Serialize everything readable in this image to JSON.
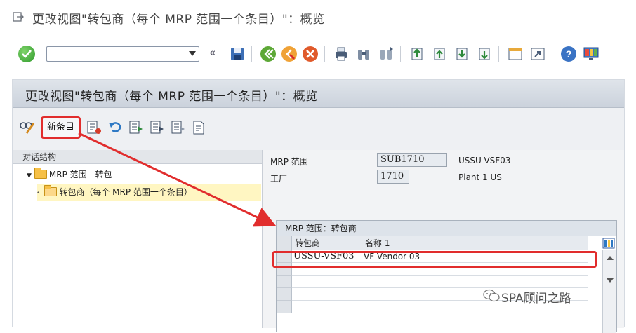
{
  "window": {
    "title": "更改视图\"转包商（每个 MRP 范围一个条目）\"：概览"
  },
  "toolbar": {
    "command_value": "",
    "collapse_symbol": "«"
  },
  "panel": {
    "title": "更改视图\"转包商（每个 MRP 范围一个条目）\"：概览"
  },
  "app_toolbar": {
    "new_entries_label": "新条目"
  },
  "dialog_structure": {
    "header": "对话结构",
    "nodes": [
      {
        "label": "MRP 范围 - 转包"
      },
      {
        "label": "转包商（每个 MRP 范围一个条目）"
      }
    ]
  },
  "fields": {
    "mrp_area": {
      "label": "MRP 范围",
      "value": "SUB1710",
      "description": "USSU-VSF03"
    },
    "plant": {
      "label": "工厂",
      "value": "1710",
      "description": "Plant 1 US"
    }
  },
  "table": {
    "title": "MRP 范围：转包商",
    "columns": [
      "转包商",
      "名称 1"
    ],
    "rows": [
      {
        "subcontractor": "USSU-VSF03",
        "name": "VF Vendor 03"
      }
    ]
  },
  "watermark": {
    "text": "SPA顾问之路"
  },
  "colors": {
    "highlight": "#e12d2d",
    "folder": "#f6c046",
    "selected_node": "#fff6c2"
  }
}
